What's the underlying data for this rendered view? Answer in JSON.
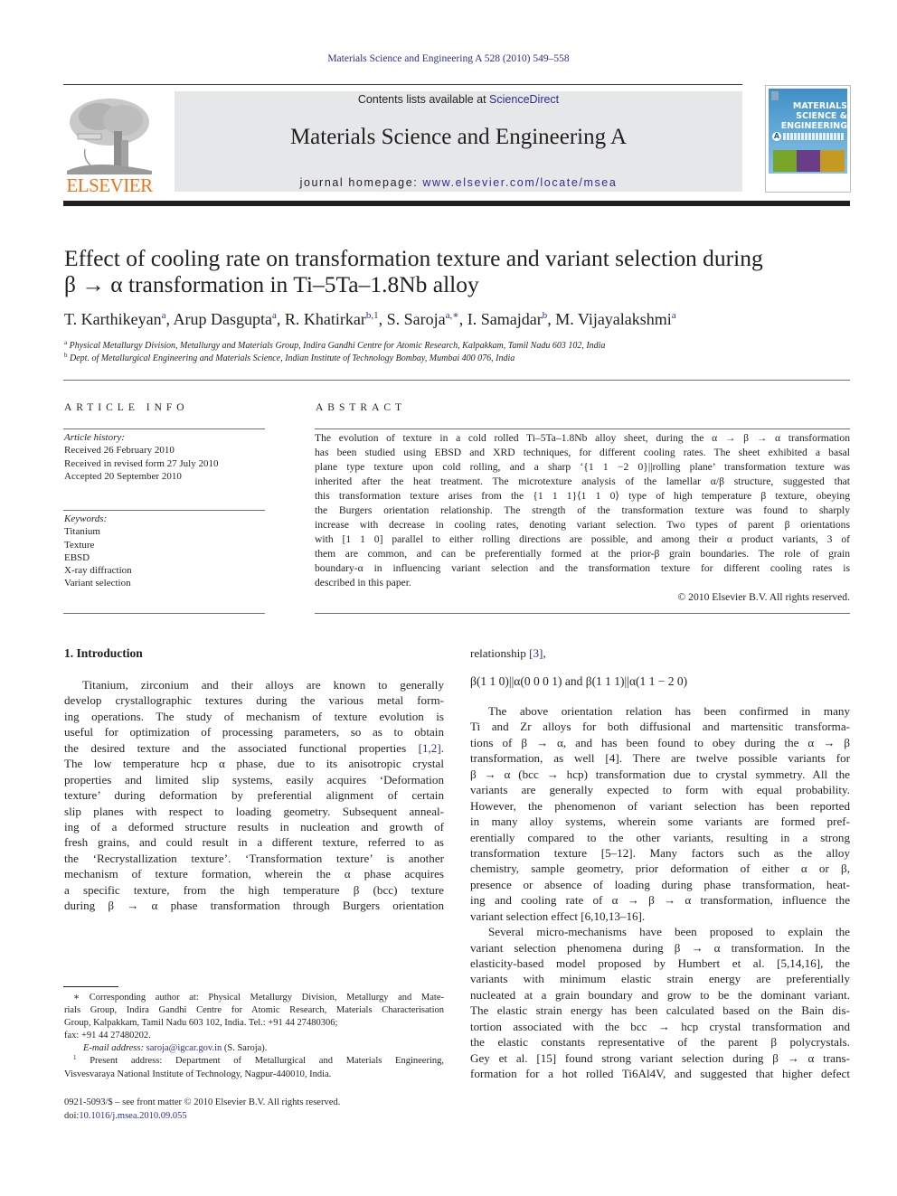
{
  "running_head": "Materials Science and Engineering A 528 (2010) 549–558",
  "masthead": {
    "publisher_logo_text": "ELSEVIER",
    "contents_prefix": "Contents lists available at ",
    "contents_link": "ScienceDirect",
    "journal_title": "Materials Science and Engineering A",
    "homepage_prefix": "journal homepage: ",
    "homepage_link": "www.elsevier.com/locate/msea",
    "cover": {
      "title_lines": [
        "MATERIALS",
        "SCIENCE &",
        "ENGINEERING"
      ],
      "badge": "A"
    },
    "colors": {
      "link": "#2b2f8f",
      "elsevier_orange": "#e8751a",
      "band": "#e6e7e8"
    }
  },
  "article": {
    "title_lines": [
      "Effect of cooling rate on transformation texture and variant selection during",
      "β → α transformation in Ti–5Ta–1.8Nb alloy"
    ],
    "authors": [
      {
        "name": "T. Karthikeyan",
        "sup": "a"
      },
      {
        "name": "Arup Dasgupta",
        "sup": "a"
      },
      {
        "name": "R. Khatirkar",
        "sup": "b,1"
      },
      {
        "name": "S. Saroja",
        "sup": "a,∗"
      },
      {
        "name": "I. Samajdar",
        "sup": "b"
      },
      {
        "name": "M. Vijayalakshmi",
        "sup": "a"
      }
    ],
    "affiliations": [
      {
        "key": "a",
        "text": "Physical Metallurgy Division, Metallurgy and Materials Group, Indira Gandhi Centre for Atomic Research, Kalpakkam, Tamil Nadu 603 102, India"
      },
      {
        "key": "b",
        "text": "Dept. of Metallurgical Engineering and Materials Science, Indian Institute of Technology Bombay, Mumbai 400 076, India"
      }
    ]
  },
  "article_info": {
    "heading": "ARTICLE INFO",
    "history_label": "Article history:",
    "history": [
      "Received 26 February 2010",
      "Received in revised form 27 July 2010",
      "Accepted 20 September 2010"
    ],
    "keywords_label": "Keywords:",
    "keywords": [
      "Titanium",
      "Texture",
      "EBSD",
      "X-ray diffraction",
      "Variant selection"
    ]
  },
  "abstract": {
    "heading": "ABSTRACT",
    "lines": [
      "The evolution of texture in a cold rolled Ti–5Ta–1.8Nb alloy sheet, during the α → β → α transformation",
      "has been studied using EBSD and XRD techniques, for different cooling rates. The sheet exhibited a basal",
      "plane type texture upon cold rolling, and a sharp ‘{1 1 −2 0}||rolling plane’ transformation texture was",
      "inherited after the heat treatment. The microtexture analysis of the lamellar α/β structure, suggested that",
      "this transformation texture arises from the {1 1 1}⟨1 1 0⟩ type of high temperature β texture, obeying",
      "the Burgers orientation relationship. The strength of the transformation texture was found to sharply",
      "increase with decrease in cooling rates, denoting variant selection. Two types of parent β orientations",
      "with [1 1 0] parallel to either rolling directions are possible, and among their α product variants, 3 of",
      "them are common, and can be preferentially formed at the prior-β grain boundaries. The role of grain",
      "boundary-α in influencing variant selection and the transformation texture for different cooling rates is",
      "described in this paper."
    ],
    "copyright": "© 2010 Elsevier B.V. All rights reserved."
  },
  "intro": {
    "heading": "1.  Introduction",
    "left_lines": [
      "Titanium, zirconium and their alloys are known to generally",
      "develop crystallographic textures during the various metal form-",
      "ing operations. The study of mechanism of texture evolution is",
      "useful for optimization of processing parameters, so as to obtain",
      "the desired texture and the associated functional properties ",
      "The low temperature hcp α phase, due to its anisotropic crystal",
      "properties and limited slip systems, easily acquires ‘Deformation",
      "texture’ during deformation by preferential alignment of certain",
      "slip planes with respect to loading geometry. Subsequent anneal-",
      "ing of a deformed structure results in nucleation and growth of",
      "fresh grains, and could result in a different texture, referred to as",
      "the ‘Recrystallization texture’. ‘Transformation texture’ is another",
      "mechanism of texture formation, wherein the α phase acquires",
      "a specific texture, from the high temperature β (bcc) texture",
      "during β → α phase transformation through Burgers orientation"
    ],
    "ref_1_2": "[1,2]",
    "right_first": "relationship ",
    "ref_3": "[3]",
    "equation": "β(1 1 0)||α(0 0 0 1)   and   β(1 1 1)||α(1 1 − 2 0)",
    "right_para1": [
      "The above orientation relation has been confirmed in many",
      "Ti and Zr alloys for both diffusional and martensitic transforma-",
      "tions of β → α, and has been found to obey during the α → β",
      "transformation, as well [4]. There are twelve possible variants for",
      "β → α (bcc → hcp) transformation due to crystal symmetry. All the",
      "variants are generally expected to form with equal probability.",
      "However, the phenomenon of variant selection has been reported",
      "in many alloy systems, wherein some variants are formed pref-",
      "erentially compared to the other variants, resulting in a strong",
      "transformation texture [5–12]. Many factors such as the alloy",
      "chemistry, sample geometry, prior deformation of either α or β,",
      "presence or absence of loading during phase transformation, heat-",
      "ing and cooling rate of α → β → α transformation, influence the",
      "variant selection effect [6,10,13–16]."
    ],
    "right_para2": [
      "Several micro-mechanisms have been proposed to explain the",
      "variant selection phenomena during β → α transformation. In the",
      "elasticity-based model proposed by Humbert et al. [5,14,16], the",
      "variants with minimum elastic strain energy are preferentially",
      "nucleated at a grain boundary and grow to be the dominant variant.",
      "The elastic strain energy has been calculated based on the Bain dis-",
      "tortion associated with the bcc → hcp crystal transformation and",
      "the elastic constants representative of the parent β polycrystals.",
      "Gey et al. [15] found strong variant selection during β → α trans-",
      "formation for a hot rolled Ti6Al4V, and suggested that higher defect"
    ]
  },
  "footnotes": {
    "corresponding": [
      "∗ Corresponding author at: Physical Metallurgy Division, Metallurgy and Mate-",
      "rials Group, Indira Gandhi Centre for Atomic Research, Materials Characterisation",
      "Group, Kalpakkam, Tamil Nadu 603 102, India. Tel.: +91 44 27480306;",
      "fax: +91 44 27480202."
    ],
    "email_label": "E-mail address: ",
    "email": "saroja@igcar.gov.in",
    "email_suffix": " (S. Saroja).",
    "present_address": [
      "Present address: Department of Metallurgical and Materials Engineering,",
      "Visvesvaraya National Institute of Technology, Nagpur-440010, India."
    ],
    "present_key": "1"
  },
  "frontmatter": {
    "issn_line": "0921-5093/$ – see front matter © 2010 Elsevier B.V. All rights reserved.",
    "doi_prefix": "doi:",
    "doi": "10.1016/j.msea.2010.09.055"
  }
}
